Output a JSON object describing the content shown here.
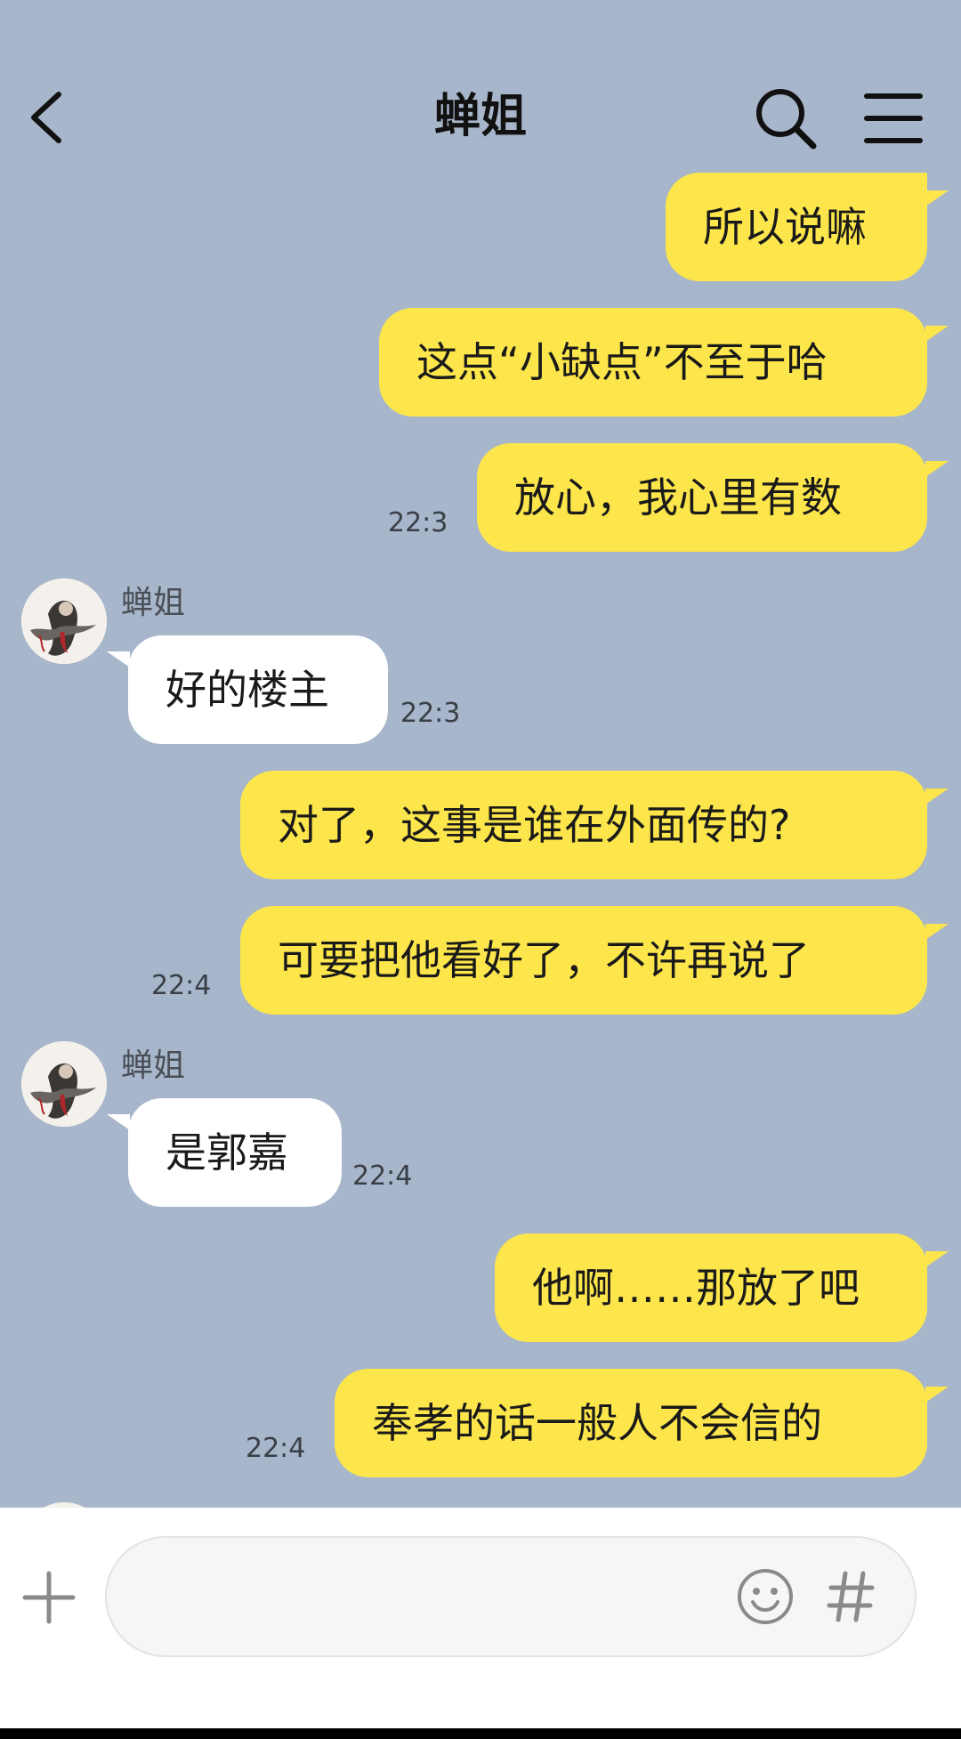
{
  "header": {
    "title": "蝉姐",
    "back_icon": "chevron-left-icon",
    "search_icon": "search-icon",
    "menu_icon": "hamburger-menu-icon"
  },
  "messages": [
    {
      "sender": "me",
      "text": "所以说嘛",
      "time": ""
    },
    {
      "sender": "me",
      "text": "这点“小缺点”不至于哈",
      "time": ""
    },
    {
      "sender": "me",
      "text": "放心，我心里有数",
      "time": "22:3"
    },
    {
      "sender": "蝉姐",
      "text": "好的楼主",
      "time": "22:3"
    },
    {
      "sender": "me",
      "text": "对了，这事是谁在外面传的?",
      "time": ""
    },
    {
      "sender": "me",
      "text": "可要把他看好了，不许再说了",
      "time": "22:4"
    },
    {
      "sender": "蝉姐",
      "text": "是郭嘉",
      "time": "22:4"
    },
    {
      "sender": "me",
      "text": "他啊……那放了吧",
      "time": ""
    },
    {
      "sender": "me",
      "text": "奉孝的话一般人不会信的",
      "time": "22:4"
    }
  ],
  "input_bar": {
    "plus_icon": "plus-icon",
    "message_value": "",
    "message_placeholder": "",
    "emoji_icon": "smiley-icon",
    "hashtag_icon": "hashtag-icon"
  },
  "colors": {
    "chat_background": "#a7b6ca",
    "my_bubble": "#fde64b",
    "their_bubble": "#ffffff",
    "input_bar_background": "#ffffff"
  }
}
